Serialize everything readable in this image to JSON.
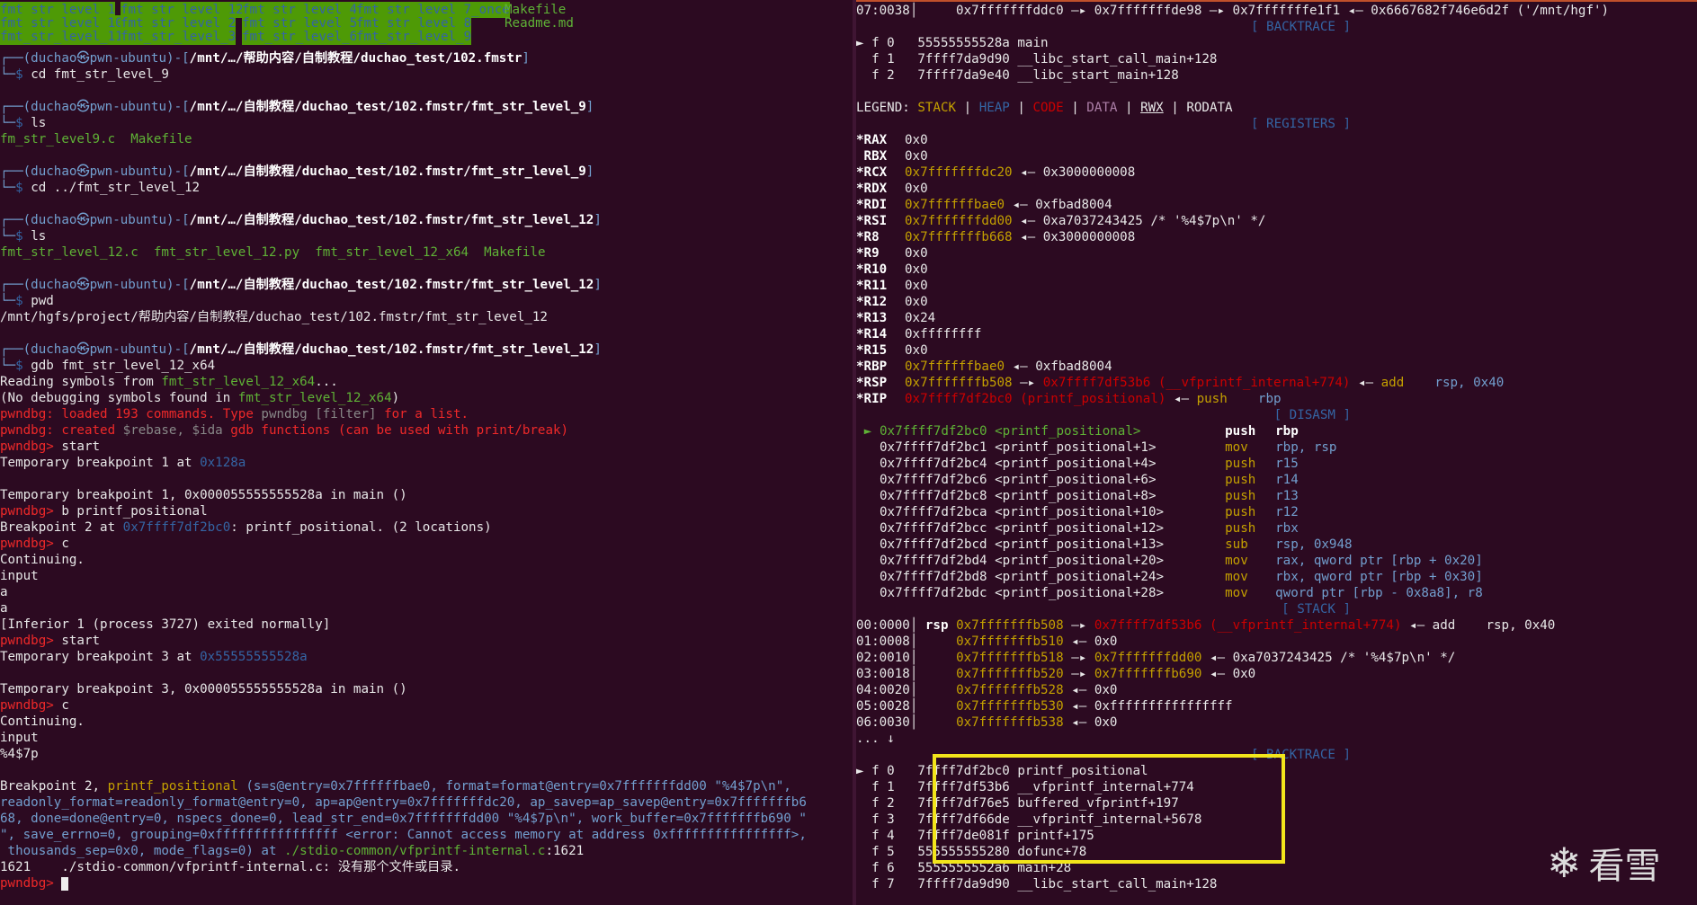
{
  "left": {
    "ls_grid": [
      [
        "fmt_str_level_1",
        "fmt_str_level_12",
        "fmt_str_level_4",
        "fmt_str_level_7_once",
        "Makefile"
      ],
      [
        "fmt_str_level_10",
        "fmt_str_level_2",
        "fmt_str_level_5",
        "fmt_str_level_8",
        "Readme.md"
      ],
      [
        "fmt_str_level_11",
        "fmt_str_level_3",
        "fmt_str_level_6",
        "fmt_str_level_9",
        ""
      ]
    ],
    "user": "(duchao㉿pwn-ubuntu)",
    "paths": {
      "p1": "/mnt/…/帮助内容/自制教程/duchao_test/102.fmstr",
      "p2": "/mnt/…/自制教程/duchao_test/102.fmstr/fmt_str_level_9",
      "p3": "/mnt/…/自制教程/duchao_test/102.fmstr/fmt_str_level_12"
    },
    "cmds": {
      "c1": "cd fmt_str_level_9",
      "c2": "ls",
      "c3": "cd ../fmt_str_level_12",
      "c4": "ls",
      "c5": "pwd",
      "c6": "gdb fmt_str_level_12_x64"
    },
    "ls1": [
      "fm_str_level9.c",
      "Makefile"
    ],
    "ls2": [
      "fmt_str_level_12.c",
      "fmt_str_level_12.py",
      "fmt_str_level_12_x64",
      "Makefile"
    ],
    "pwd_out": "/mnt/hgfs/project/帮助内容/自制教程/duchao_test/102.fmstr/fmt_str_level_12",
    "gdb": {
      "reading_pre": "Reading symbols from ",
      "reading_file": "fmt_str_level_12_x64",
      "reading_post": "...",
      "nodebug_pre": "(No debugging symbols found in ",
      "nodebug_file": "fmt_str_level_12_x64",
      "nodebug_post": ")",
      "loaded_pre": "pwndbg: loaded 193 commands. Type ",
      "loaded_mid": "pwndbg [filter]",
      "loaded_post": " for a list.",
      "created_pre": "pwndbg: created ",
      "created_vars": "$rebase, $ida",
      "created_post": " gdb functions (can be used with print/break)",
      "prompt": "pwndbg> ",
      "start1": "start",
      "tb1_pre": "Temporary breakpoint 1 at ",
      "tb1_addr": "0x128a",
      "tb1_hit": "Temporary breakpoint 1, 0x000055555555528a in main ()",
      "b_cmd": "b printf_positional",
      "bp2_pre": "Breakpoint 2 at ",
      "bp2_addr": "0x7ffff7df2bc0",
      "bp2_post": ": printf_positional. (2 locations)",
      "c1": "c",
      "continuing1": "Continuing.",
      "input1": "input",
      "a1": "a",
      "a2": "a",
      "exited": "[Inferior 1 (process 3727) exited normally]",
      "start2": "start",
      "tb3_pre": "Temporary breakpoint 3 at ",
      "tb3_addr": "0x55555555528a",
      "tb3_hit": "Temporary breakpoint 3, 0x000055555555528a in main ()",
      "c2": "c",
      "continuing2": "Continuing.",
      "input2": "input",
      "fmt_in": "%4$7p",
      "bp2_hit_l1_pre": "Breakpoint 2, ",
      "bp2_hit_l1_fn": "printf_positional",
      "bp2_hit_l1_rest": " (s=s@entry=0x7ffffffbae0, format=format@entry=0x7fffffffdd00 \"%4$7p\\n\",",
      "bp2_hit_l2": "readonly_format=readonly_format@entry=0, ap=ap@entry=0x7fffffffdc20, ap_savep=ap_savep@entry=0x7fffffffb6",
      "bp2_hit_l3": "68, done=done@entry=0, nspecs_done=0, lead_str_end=0x7fffffffdd00 \"%4$7p\\n\", work_buffer=0x7fffffffb690 \"",
      "bp2_hit_l4": "\", save_errno=0, grouping=0xffffffffffffffff <error: Cannot access memory at address 0xffffffffffffffff>,",
      "bp2_hit_l5_pre": " thousands_sep=0x0, mode_flags=0) at ",
      "bp2_hit_l5_file": "./stdio-common/vfprintf-internal.c",
      "bp2_hit_l5_post": ":1621",
      "srcline": "1621\t./stdio-common/vfprintf-internal.c: 没有那个文件或目录.",
      "final_prompt": "pwndbg> "
    }
  },
  "right": {
    "stack_top": "07:0038│     0x7fffffffddc0 —▸ 0x7fffffffde98 —▸ 0x7fffffffe1f1 ◂— 0x6667682f746e6d2f ('/mnt/hgf')",
    "backtrace_hdr": "[ BACKTRACE ]",
    "bt1": [
      {
        "f": "► f 0",
        "addr": "55555555528a",
        "sym": "main"
      },
      {
        "f": "  f 1",
        "addr": "7ffff7da9d90",
        "sym": "__libc_start_call_main+128"
      },
      {
        "f": "  f 2",
        "addr": "7ffff7da9e40",
        "sym": "__libc_start_main+128"
      }
    ],
    "legend": {
      "label": "LEGEND: ",
      "stack": "STACK",
      "heap": "HEAP",
      "code": "CODE",
      "data": "DATA",
      "rwx": "RWX",
      "rodata": "RODATA",
      "sep": " | "
    },
    "registers_hdr": "[ REGISTERS ]",
    "registers": [
      {
        "n": "*RAX",
        "v": "0x0",
        "t": ""
      },
      {
        "n": " RBX",
        "v": "0x0",
        "t": ""
      },
      {
        "n": "*RCX",
        "v": "0x7fffffffdc20",
        "t": " ◂— 0x3000000008",
        "c": "yel"
      },
      {
        "n": "*RDX",
        "v": "0x0",
        "t": ""
      },
      {
        "n": "*RDI",
        "v": "0x7ffffffbae0",
        "t": " ◂— 0xfbad8004",
        "c": "yel"
      },
      {
        "n": "*RSI",
        "v": "0x7fffffffdd00",
        "t": " ◂— 0xa7037243425 /* '%4$7p\\n' */",
        "c": "yel"
      },
      {
        "n": "*R8",
        "v": "0x7fffffffb668",
        "t": " ◂— 0x3000000008",
        "c": "yel"
      },
      {
        "n": "*R9",
        "v": "0x0",
        "t": ""
      },
      {
        "n": "*R10",
        "v": "0x0",
        "t": ""
      },
      {
        "n": "*R11",
        "v": "0x0",
        "t": ""
      },
      {
        "n": "*R12",
        "v": "0x0",
        "t": ""
      },
      {
        "n": "*R13",
        "v": "0x24",
        "t": ""
      },
      {
        "n": "*R14",
        "v": "0xffffffff",
        "t": ""
      },
      {
        "n": "*R15",
        "v": "0x0",
        "t": ""
      },
      {
        "n": "*RBP",
        "v": "0x7ffffffbae0",
        "t": " ◂— 0xfbad8004",
        "c": "yel"
      }
    ],
    "rsp": {
      "n": "*RSP",
      "v": "0x7fffffffb508",
      "arrow": " —▸ ",
      "t": "0x7ffff7df53b6 (__vfprintf_internal+774)",
      "post": " ◂— ",
      "ins": "add",
      "ops": "    rsp, 0x40"
    },
    "rip": {
      "n": "*RIP",
      "v": "0x7ffff7df2bc0 (printf_positional)",
      "post": " ◂— ",
      "ins": "push",
      "ops": "    rbp"
    },
    "disasm_hdr": "[ DISASM ]",
    "disasm": [
      {
        "m": "►",
        "addr": "0x7ffff7df2bc0",
        "sym": "<printf_positional>",
        "ins": "push",
        "ops": "rbp",
        "cur": true
      },
      {
        "m": " ",
        "addr": "0x7ffff7df2bc1",
        "sym": "<printf_positional+1>",
        "ins": "mov",
        "ops": "rbp, rsp"
      },
      {
        "m": " ",
        "addr": "0x7ffff7df2bc4",
        "sym": "<printf_positional+4>",
        "ins": "push",
        "ops": "r15"
      },
      {
        "m": " ",
        "addr": "0x7ffff7df2bc6",
        "sym": "<printf_positional+6>",
        "ins": "push",
        "ops": "r14"
      },
      {
        "m": " ",
        "addr": "0x7ffff7df2bc8",
        "sym": "<printf_positional+8>",
        "ins": "push",
        "ops": "r13"
      },
      {
        "m": " ",
        "addr": "0x7ffff7df2bca",
        "sym": "<printf_positional+10>",
        "ins": "push",
        "ops": "r12"
      },
      {
        "m": " ",
        "addr": "0x7ffff7df2bcc",
        "sym": "<printf_positional+12>",
        "ins": "push",
        "ops": "rbx"
      },
      {
        "m": " ",
        "addr": "0x7ffff7df2bcd",
        "sym": "<printf_positional+13>",
        "ins": "sub",
        "ops": "rsp, 0x948"
      },
      {
        "m": " ",
        "addr": "0x7ffff7df2bd4",
        "sym": "<printf_positional+20>",
        "ins": "mov",
        "ops": "rax, qword ptr [rbp + 0x20]"
      },
      {
        "m": " ",
        "addr": "0x7ffff7df2bd8",
        "sym": "<printf_positional+24>",
        "ins": "mov",
        "ops": "rbx, qword ptr [rbp + 0x30]"
      },
      {
        "m": " ",
        "addr": "0x7ffff7df2bdc",
        "sym": "<printf_positional+28>",
        "ins": "mov",
        "ops": "qword ptr [rbp - 0x8a8], r8"
      }
    ],
    "stack_hdr": "[ STACK ]",
    "stack": [
      {
        "off": "00:0000│",
        "reg": " rsp ",
        "addr": "0x7fffffffb508",
        "rest": " —▸ ",
        "tgt": "0x7ffff7df53b6 (__vfprintf_internal+774)",
        "post": " ◂— add    rsp, 0x40"
      },
      {
        "off": "01:0008│",
        "reg": "     ",
        "addr": "0x7fffffffb510",
        "rest": " ◂— 0x0",
        "tgt": "",
        "post": ""
      },
      {
        "off": "02:0010│",
        "reg": "     ",
        "addr": "0x7fffffffb518",
        "rest": " —▸ ",
        "tgt": "0x7fffffffdd00",
        "post": " ◂— 0xa7037243425 /* '%4$7p\\n' */"
      },
      {
        "off": "03:0018│",
        "reg": "     ",
        "addr": "0x7fffffffb520",
        "rest": " —▸ ",
        "tgt": "0x7fffffffb690",
        "post": " ◂— 0x0"
      },
      {
        "off": "04:0020│",
        "reg": "     ",
        "addr": "0x7fffffffb528",
        "rest": " ◂— 0x0",
        "tgt": "",
        "post": ""
      },
      {
        "off": "05:0028│",
        "reg": "     ",
        "addr": "0x7fffffffb530",
        "rest": " ◂— 0xffffffffffffffff",
        "tgt": "",
        "post": ""
      },
      {
        "off": "06:0030│",
        "reg": "     ",
        "addr": "0x7fffffffb538",
        "rest": " ◂— 0x0",
        "tgt": "",
        "post": ""
      }
    ],
    "more": "... ↓",
    "bt2": [
      {
        "f": "► f 0",
        "addr": "7ffff7df2bc0",
        "sym": "printf_positional"
      },
      {
        "f": "  f 1",
        "addr": "7ffff7df53b6",
        "sym": "__vfprintf_internal+774"
      },
      {
        "f": "  f 2",
        "addr": "7ffff7df76e5",
        "sym": "buffered_vfprintf+197"
      },
      {
        "f": "  f 3",
        "addr": "7ffff7df66de",
        "sym": "__vfprintf_internal+5678"
      },
      {
        "f": "  f 4",
        "addr": "7ffff7de081f",
        "sym": "printf+175"
      },
      {
        "f": "  f 5",
        "addr": "555555555280",
        "sym": "dofunc+78"
      },
      {
        "f": "  f 6",
        "addr": "5555555552a6",
        "sym": "main+28"
      },
      {
        "f": "  f 7",
        "addr": "7ffff7da9d90",
        "sym": "__libc_start_call_main+128"
      }
    ]
  },
  "watermark": {
    "text": "看雪"
  },
  "colors": {
    "background": "#2c0a21",
    "highlight_box": "#f2e51b",
    "prompt": "#ef2929",
    "path": "#5fb236"
  }
}
